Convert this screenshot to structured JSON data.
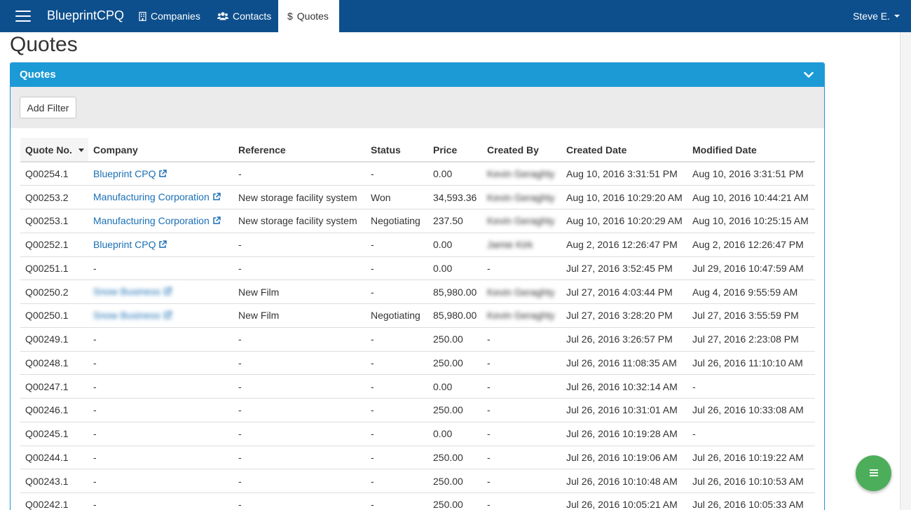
{
  "navbar": {
    "brand": "BlueprintCPQ",
    "items": [
      {
        "label": "Companies",
        "icon": "building-icon"
      },
      {
        "label": "Contacts",
        "icon": "users-icon"
      },
      {
        "label": "Quotes",
        "icon": "dollar-icon",
        "active": true
      }
    ],
    "user": "Steve E."
  },
  "page": {
    "title": "Quotes"
  },
  "panel": {
    "title": "Quotes",
    "add_filter_label": "Add Filter"
  },
  "table": {
    "headers": [
      "Quote No.",
      "Company",
      "Reference",
      "Status",
      "Price",
      "Created By",
      "Created Date",
      "Modified Date"
    ],
    "sorted_column": "Quote No.",
    "rows": [
      {
        "quote_no": "Q00254.1",
        "company": "Blueprint CPQ",
        "reference": "-",
        "status": "-",
        "price": "0.00",
        "created_by": "Kevin Geraghty",
        "created_date": "Aug 10, 2016 3:31:51 PM",
        "modified_date": "Aug 10, 2016 3:31:51 PM"
      },
      {
        "quote_no": "Q00253.2",
        "company": "Manufacturing Corporation",
        "reference": "New storage facility system",
        "status": "Won",
        "price": "34,593.36",
        "created_by": "Kevin Geraghty",
        "created_date": "Aug 10, 2016 10:29:20 AM",
        "modified_date": "Aug 10, 2016 10:44:21 AM"
      },
      {
        "quote_no": "Q00253.1",
        "company": "Manufacturing Corporation",
        "reference": "New storage facility system",
        "status": "Negotiating",
        "price": "237.50",
        "created_by": "Kevin Geraghty",
        "created_date": "Aug 10, 2016 10:20:29 AM",
        "modified_date": "Aug 10, 2016 10:25:15 AM"
      },
      {
        "quote_no": "Q00252.1",
        "company": "Blueprint CPQ",
        "reference": "-",
        "status": "-",
        "price": "0.00",
        "created_by": "Jamie Kirk",
        "created_date": "Aug 2, 2016 12:26:47 PM",
        "modified_date": "Aug 2, 2016 12:26:47 PM"
      },
      {
        "quote_no": "Q00251.1",
        "company": "-",
        "reference": "-",
        "status": "-",
        "price": "0.00",
        "created_by": "-",
        "created_date": "Jul 27, 2016 3:52:45 PM",
        "modified_date": "Jul 29, 2016 10:47:59 AM"
      },
      {
        "quote_no": "Q00250.2",
        "company": "Snow Business",
        "reference": "New Film",
        "status": "-",
        "price": "85,980.00",
        "created_by": "Kevin Geraghty",
        "created_date": "Jul 27, 2016 4:03:44 PM",
        "modified_date": "Aug 4, 2016 9:55:59 AM"
      },
      {
        "quote_no": "Q00250.1",
        "company": "Snow Business",
        "reference": "New Film",
        "status": "Negotiating",
        "price": "85,980.00",
        "created_by": "Kevin Geraghty",
        "created_date": "Jul 27, 2016 3:28:20 PM",
        "modified_date": "Jul 27, 2016 3:55:59 PM"
      },
      {
        "quote_no": "Q00249.1",
        "company": "-",
        "reference": "-",
        "status": "-",
        "price": "250.00",
        "created_by": "-",
        "created_date": "Jul 26, 2016 3:26:57 PM",
        "modified_date": "Jul 27, 2016 2:23:08 PM"
      },
      {
        "quote_no": "Q00248.1",
        "company": "-",
        "reference": "-",
        "status": "-",
        "price": "250.00",
        "created_by": "-",
        "created_date": "Jul 26, 2016 11:08:35 AM",
        "modified_date": "Jul 26, 2016 11:10:10 AM"
      },
      {
        "quote_no": "Q00247.1",
        "company": "-",
        "reference": "-",
        "status": "-",
        "price": "0.00",
        "created_by": "-",
        "created_date": "Jul 26, 2016 10:32:14 AM",
        "modified_date": "-"
      },
      {
        "quote_no": "Q00246.1",
        "company": "-",
        "reference": "-",
        "status": "-",
        "price": "250.00",
        "created_by": "-",
        "created_date": "Jul 26, 2016 10:31:01 AM",
        "modified_date": "Jul 26, 2016 10:33:08 AM"
      },
      {
        "quote_no": "Q00245.1",
        "company": "-",
        "reference": "-",
        "status": "-",
        "price": "0.00",
        "created_by": "-",
        "created_date": "Jul 26, 2016 10:19:28 AM",
        "modified_date": "-"
      },
      {
        "quote_no": "Q00244.1",
        "company": "-",
        "reference": "-",
        "status": "-",
        "price": "250.00",
        "created_by": "-",
        "created_date": "Jul 26, 2016 10:19:06 AM",
        "modified_date": "Jul 26, 2016 10:19:22 AM"
      },
      {
        "quote_no": "Q00243.1",
        "company": "-",
        "reference": "-",
        "status": "-",
        "price": "250.00",
        "created_by": "-",
        "created_date": "Jul 26, 2016 10:10:48 AM",
        "modified_date": "Jul 26, 2016 10:10:53 AM"
      },
      {
        "quote_no": "Q00242.1",
        "company": "-",
        "reference": "-",
        "status": "-",
        "price": "250.00",
        "created_by": "-",
        "created_date": "Jul 26, 2016 10:05:21 AM",
        "modified_date": "Jul 26, 2016 10:05:33 AM"
      }
    ]
  },
  "fab": {
    "icon": "list-icon"
  },
  "colors": {
    "navbar_bg": "#0d4f8c",
    "panel_header_bg": "#1c9ad6",
    "link": "#1a6fb5",
    "fab_bg": "#4cae5a"
  }
}
